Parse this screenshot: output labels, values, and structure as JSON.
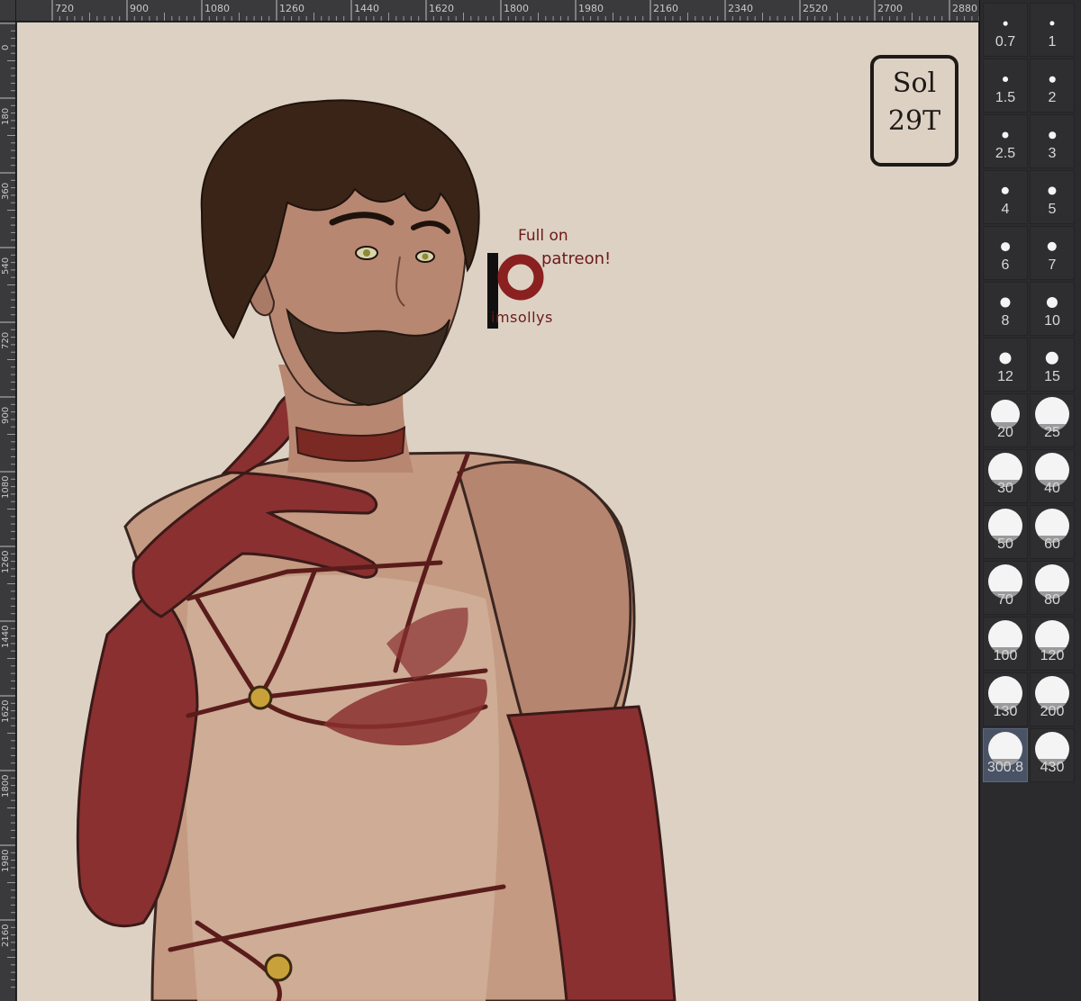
{
  "ruler_top": {
    "labels": [
      "720",
      "900",
      "1080",
      "1260",
      "1440",
      "1620",
      "1800",
      "1980",
      "2160",
      "2340",
      "2520",
      "2700",
      "2880"
    ]
  },
  "ruler_left": {
    "labels": [
      "0",
      "180",
      "360",
      "540",
      "720",
      "900",
      "1080",
      "1260",
      "1440",
      "1620",
      "1800",
      "1980",
      "2160"
    ]
  },
  "canvas": {
    "background_color": "#ddd1c4",
    "patreon_note": {
      "line1": "Full on",
      "line2": "patreon!",
      "handle": "imsollys"
    },
    "signature": {
      "line1": "Sol",
      "line2": "29T"
    }
  },
  "brush_panel": {
    "selected_value": "300.8",
    "sizes": [
      "0.7",
      "1",
      "1.5",
      "2",
      "2.5",
      "3",
      "4",
      "5",
      "6",
      "7",
      "8",
      "10",
      "12",
      "15",
      "20",
      "25",
      "30",
      "40",
      "50",
      "60",
      "70",
      "80",
      "100",
      "120",
      "130",
      "200",
      "300.8",
      "430"
    ]
  }
}
